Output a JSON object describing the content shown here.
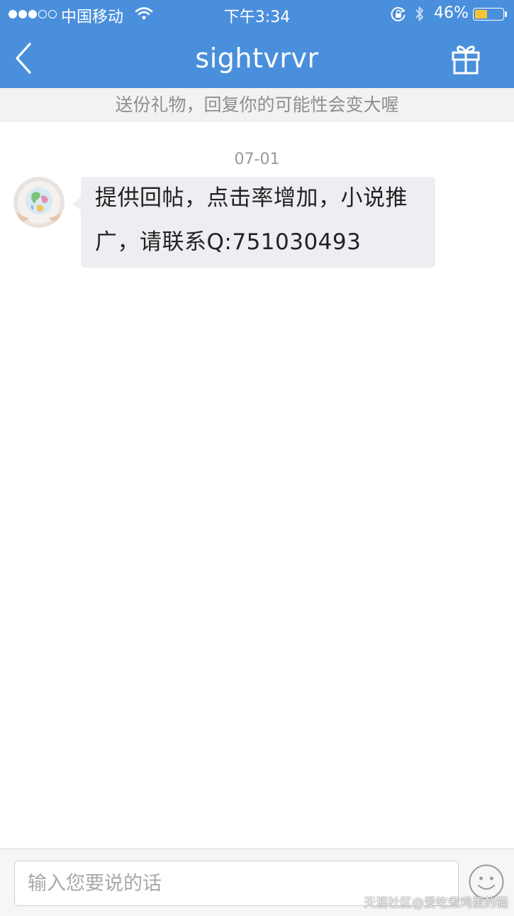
{
  "status_bar": {
    "carrier": "中国移动",
    "time": "下午3:34",
    "battery_percent_text": "46%",
    "battery_level": 0.46,
    "signal_bars_filled": 3,
    "signal_bars_total": 5
  },
  "nav": {
    "title": "sightvrvr",
    "back_icon": "chevron-left-icon",
    "gift_icon": "gift-icon"
  },
  "hint": {
    "text": "送份礼物，回复你的可能性会变大喔"
  },
  "messages": [
    {
      "date": "07-01",
      "text": "提供回帖，点击率增加，小说推广，请联系Q:751030493"
    }
  ],
  "composer": {
    "placeholder": "输入您要说的话",
    "emoji_icon": "smiley-icon"
  },
  "watermark": {
    "text": "天涯社区@爱吃煮鸡蛋的猫"
  },
  "colors": {
    "nav_background": "#4a8fdc",
    "bubble_background": "#eceef1",
    "battery_fill": "#f6c535"
  }
}
